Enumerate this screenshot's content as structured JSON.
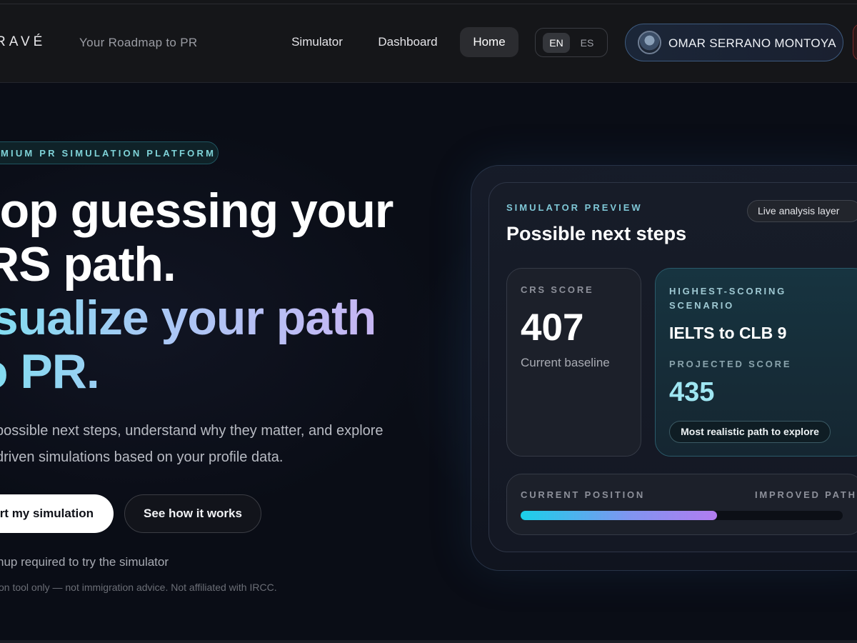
{
  "header": {
    "brand": "RAVÉ",
    "tagline": "Your Roadmap to PR",
    "nav": {
      "simulator": "Simulator",
      "dashboard": "Dashboard",
      "home": "Home"
    },
    "languages": {
      "en": "EN",
      "es": "ES",
      "selected": "EN"
    },
    "user_name": "OMAR SERRANO MONTOYA"
  },
  "hero": {
    "badge": "MIUM PR SIMULATION PLATFORM",
    "headline_line1": "top guessing your",
    "headline_line2": "RS path.",
    "gradient_line1": "isualize your path",
    "gradient_line2": "o PR.",
    "sub_line1": "possible next steps, understand why they matter, and explore",
    "sub_line2": "driven simulations based on your profile data.",
    "cta_primary": "art my simulation",
    "cta_secondary": "See how it works",
    "note_1": "nup required to try the simulator",
    "note_2": "on tool only — not immigration advice. Not affiliated with IRCC."
  },
  "preview": {
    "eyebrow": "SIMULATOR PREVIEW",
    "title": "Possible next steps",
    "live_chip": "Live analysis layer",
    "crs": {
      "label": "CRS SCORE",
      "value": "407",
      "sub": "Current baseline"
    },
    "scenario": {
      "label": "HIGHEST-SCORING SCENARIO",
      "title": "IELTS to CLB 9",
      "projected_label": "PROJECTED SCORE",
      "projected_value": "435",
      "chip": "Most realistic path to explore"
    },
    "position": {
      "current_label": "CURRENT POSITION",
      "improved_label": "IMPROVED PATH",
      "progress_fraction": 0.61
    }
  },
  "colors": {
    "background": "#0a0d16",
    "accent_cyan": "#7fdff0",
    "accent_violet": "#c7b6f3",
    "projected": "#9fe6f2"
  },
  "icons": [
    "avatar-image"
  ]
}
